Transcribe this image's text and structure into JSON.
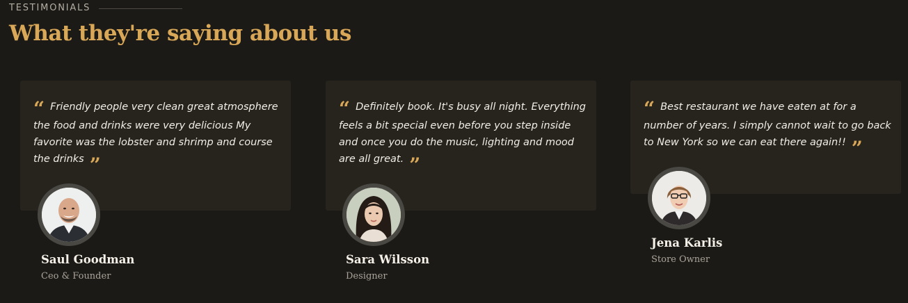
{
  "section": {
    "eyebrow": "TESTIMONIALS",
    "title": "What they're saying about us"
  },
  "testimonials": [
    {
      "quote": "Friendly people very clean great atmosphere the food and drinks were very delicious My favorite was the lobster and shrimp and course the drinks",
      "name": "Saul Goodman",
      "role": "Ceo & Founder",
      "avatar_icon": "portrait-bald-man"
    },
    {
      "quote": "Definitely book. It's busy all night. Everything feels a bit special even before you step inside and once you do the music, lighting and mood are all great.",
      "name": "Sara Wilsson",
      "role": "Designer",
      "avatar_icon": "portrait-woman-dark-hair"
    },
    {
      "quote": "Best restaurant we have eaten at for a number of years. I simply cannot wait to go back to New York so we can eat there again!!",
      "name": "Jena Karlis",
      "role": "Store Owner",
      "avatar_icon": "portrait-woman-glasses"
    }
  ],
  "colors": {
    "background": "#1b1a16",
    "card": "#27241e",
    "accent": "#d8a758",
    "text": "#f1eee7"
  }
}
